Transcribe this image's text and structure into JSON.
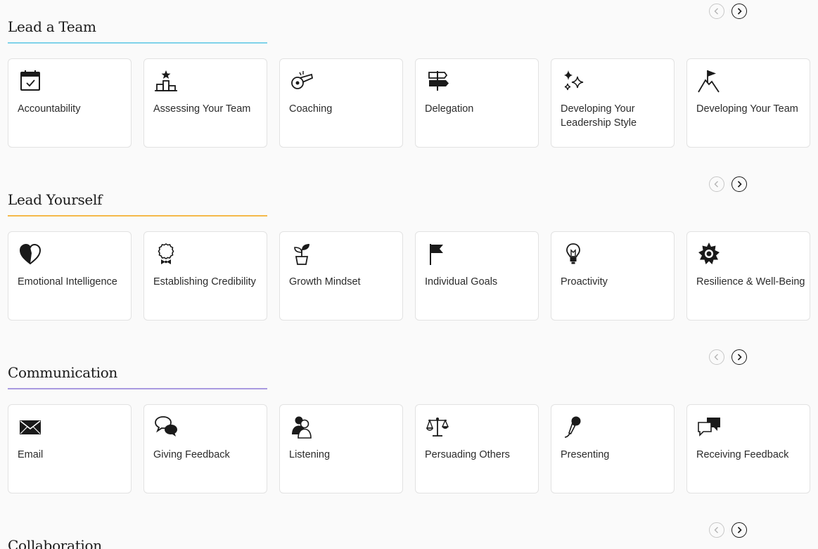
{
  "sections": [
    {
      "id": "lead-a-team",
      "title": "Lead a Team",
      "accent": "#7fd3ea",
      "cards": [
        {
          "label": "Accountability",
          "icon": "calendar-check-icon"
        },
        {
          "label": "Assessing Your Team",
          "icon": "podium-star-icon"
        },
        {
          "label": "Coaching",
          "icon": "whistle-icon"
        },
        {
          "label": "Delegation",
          "icon": "signpost-icon"
        },
        {
          "label": "Developing Your Leadership Style",
          "icon": "sparkles-icon"
        },
        {
          "label": "Developing Your Team",
          "icon": "mountain-flag-icon"
        }
      ]
    },
    {
      "id": "lead-yourself",
      "title": "Lead Yourself",
      "accent": "#f5b94a",
      "cards": [
        {
          "label": "Emotional Intelligence",
          "icon": "half-heart-icon"
        },
        {
          "label": "Establishing Credibility",
          "icon": "award-badge-icon"
        },
        {
          "label": "Growth Mindset",
          "icon": "seedling-pot-icon"
        },
        {
          "label": "Individual Goals",
          "icon": "flag-icon"
        },
        {
          "label": "Proactivity",
          "icon": "lightbulb-icon"
        },
        {
          "label": "Resilience & Well-Being",
          "icon": "sun-icon"
        }
      ]
    },
    {
      "id": "communication",
      "title": "Communication",
      "accent": "#a99ae0",
      "cards": [
        {
          "label": "Email",
          "icon": "envelope-icon"
        },
        {
          "label": "Giving Feedback",
          "icon": "speech-bubbles-icon"
        },
        {
          "label": "Listening",
          "icon": "two-people-icon"
        },
        {
          "label": "Persuading Others",
          "icon": "scales-icon"
        },
        {
          "label": "Presenting",
          "icon": "microphone-icon"
        },
        {
          "label": "Receiving Feedback",
          "icon": "chat-bubbles-icon"
        }
      ]
    },
    {
      "id": "collaboration",
      "title": "Collaboration",
      "accent": "#1a1a1a",
      "cards": []
    }
  ]
}
